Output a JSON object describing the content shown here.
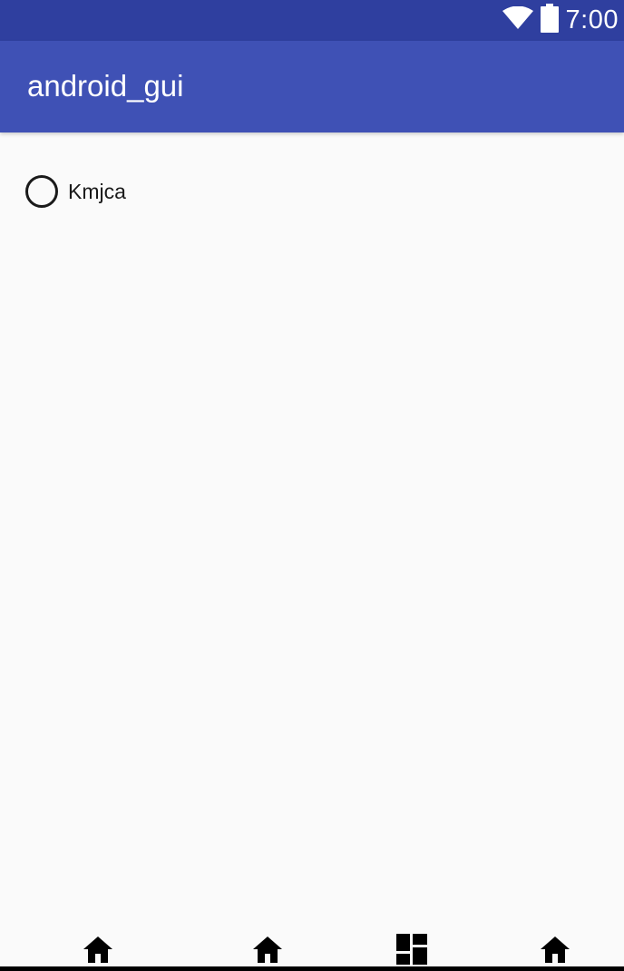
{
  "status_bar": {
    "time": "7:00",
    "icons": [
      "wifi-icon",
      "battery-icon"
    ],
    "background": "#2f3f9f"
  },
  "app_bar": {
    "title": "android_gui",
    "background": "#3f51b5"
  },
  "content": {
    "radio_button": {
      "label": "Kmjca",
      "checked": false
    }
  },
  "bottom_nav": {
    "icons": [
      "home-icon",
      "home-icon",
      "dashboard-icon",
      "home-icon"
    ]
  }
}
